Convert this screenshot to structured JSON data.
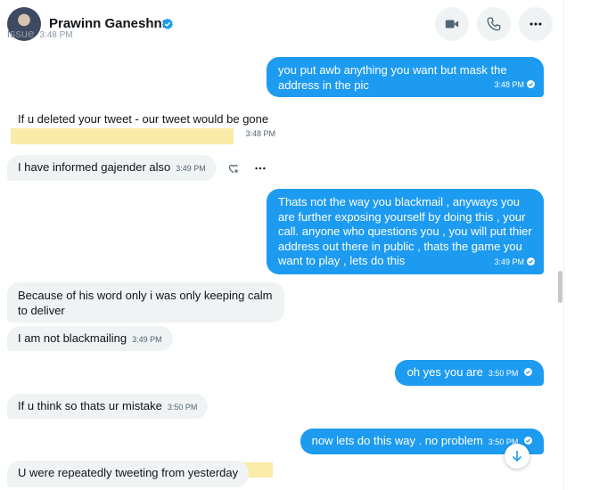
{
  "header": {
    "name": "Prawinn Ganeshnn",
    "icons": [
      "video-call-icon",
      "phone-icon",
      "more-icon"
    ]
  },
  "faded_top": {
    "text": "issue",
    "time": "3:48 PM"
  },
  "messages": [
    {
      "dir": "out",
      "text": "you put awb anything you want but mask the address in the pic",
      "time": "3:48 PM"
    },
    {
      "dir": "in",
      "text": "If u deleted your tweet - our tweet would be gone",
      "time": "3:48 PM"
    },
    {
      "dir": "in",
      "text": "I have informed gajender also",
      "time": "3:49 PM"
    },
    {
      "dir": "out",
      "text": "Thats not the way you blackmail , anyways you are further exposing yourself by doing this , your call. anyone who questions you , you will put thier address out there in public , thats the game you want to play , lets do this",
      "time": "3:49 PM"
    },
    {
      "dir": "in",
      "text": "Because of his word only i was only keeping calm to deliver",
      "time": ""
    },
    {
      "dir": "in",
      "text": "I am not blackmailing",
      "time": "3:49 PM"
    },
    {
      "dir": "out",
      "text": "oh yes you are",
      "time": "3:50 PM"
    },
    {
      "dir": "in",
      "text": "If u think so thats ur mistake",
      "time": "3:50 PM"
    },
    {
      "dir": "out",
      "text": "now lets do this way . no problem",
      "time": "3:50 PM"
    },
    {
      "dir": "in",
      "text": "U were repeatedly tweeting from yesterday",
      "time": ""
    }
  ],
  "colors": {
    "outgoing": "#1d9bf0",
    "incoming": "#eff3f4",
    "highlight": "#fbe9a0",
    "verified": "#1d9bf0"
  }
}
